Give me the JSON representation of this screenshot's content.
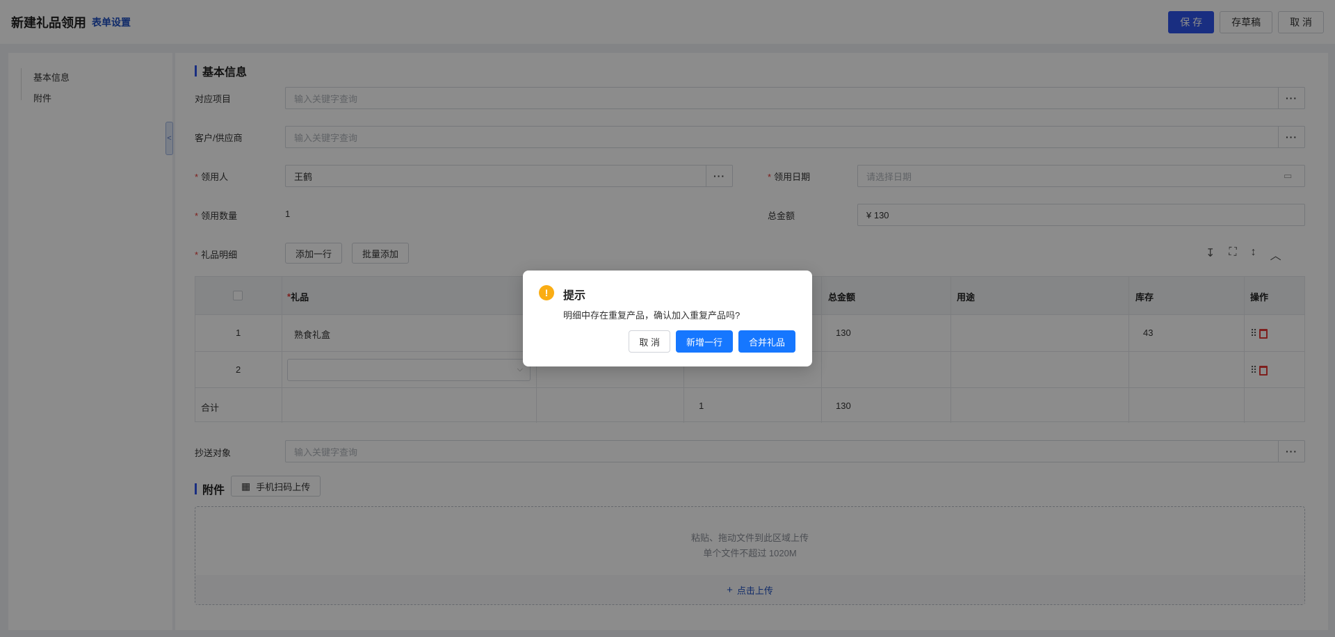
{
  "header": {
    "title": "新建礼品领用",
    "settings_link": "表单设置",
    "save": "保 存",
    "draft": "存草稿",
    "cancel": "取 消"
  },
  "nav": {
    "items": [
      "基本信息",
      "附件"
    ],
    "collapse_glyph": "<"
  },
  "basic": {
    "section_title": "基本信息",
    "project_label": "对应项目",
    "project_placeholder": "输入关键字查询",
    "customer_label": "客户/供应商",
    "customer_placeholder": "输入关键字查询",
    "recipient_label": "领用人",
    "recipient_value": "王鹤",
    "date_label": "领用日期",
    "date_placeholder": "请选择日期",
    "quantity_label": "领用数量",
    "quantity_value": "1",
    "amount_label": "总金额",
    "amount_value": "¥ 130",
    "required_mark": "*",
    "more_glyph": "···",
    "calendar_glyph": "▭"
  },
  "details": {
    "label": "礼品明细",
    "add_row": "添加一行",
    "batch_add": "批量添加",
    "columns": {
      "gift": "礼品",
      "total": "总金额",
      "usage": "用途",
      "stock": "库存",
      "actions": "操作"
    },
    "rows": [
      {
        "index": "1",
        "gift": "熟食礼盒",
        "total": "130",
        "stock": "43"
      },
      {
        "index": "2",
        "gift": "",
        "total": "",
        "stock": ""
      }
    ],
    "summary": {
      "label": "合计",
      "quantity": "1",
      "total": "130"
    },
    "tool_icons": [
      "row-height-icon",
      "fullscreen-icon",
      "vertical-resize-icon",
      "collapse-up-icon"
    ],
    "chevron_glyph": "⌵",
    "drag_glyph": "⠿"
  },
  "cc": {
    "label": "抄送对象",
    "placeholder": "输入关键字查询"
  },
  "attachment": {
    "section_title": "附件",
    "scan_upload": "手机扫码上传",
    "drop_hint": "粘贴、拖动文件到此区域上传",
    "size_limit": "单个文件不超过 1020M",
    "click_upload": "点击上传"
  },
  "dialog": {
    "title": "提示",
    "message": "明细中存在重复产品，确认加入重复产品吗?",
    "icon_glyph": "!",
    "cancel": "取 消",
    "add_row": "新增一行",
    "merge": "合并礼品"
  },
  "colors": {
    "primary": "#2f54eb",
    "dialog_button": "#1677ff",
    "warning": "#faad14",
    "danger": "#e53935"
  }
}
